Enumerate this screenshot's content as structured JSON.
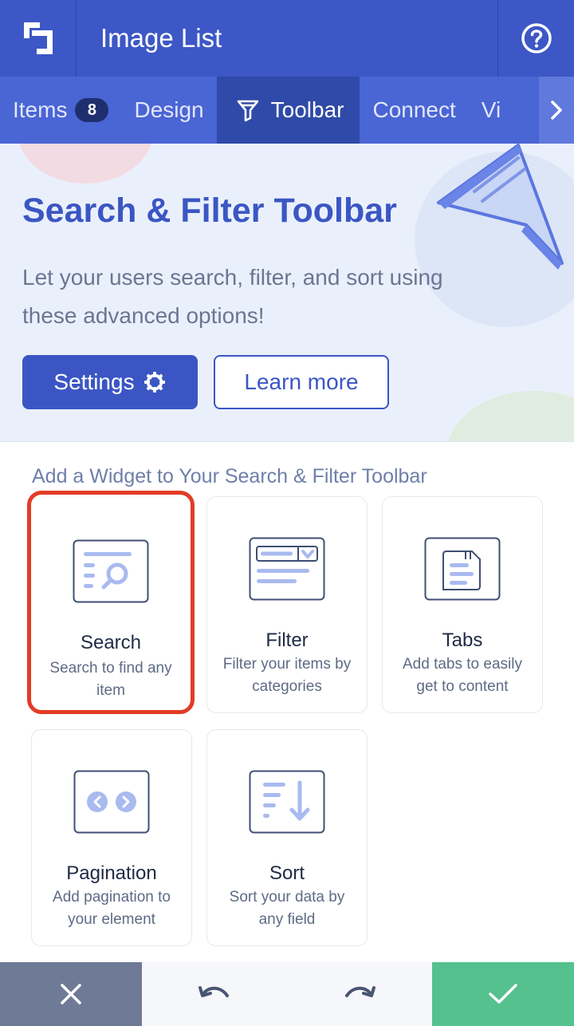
{
  "app": {
    "title": "Image List"
  },
  "tabs": [
    {
      "label": "Items",
      "badge": "8"
    },
    {
      "label": "Design"
    },
    {
      "label": "Toolbar",
      "active": true
    },
    {
      "label": "Connect"
    },
    {
      "label": "Vi"
    }
  ],
  "banner": {
    "title": "Search & Filter Toolbar",
    "description": "Let your users search, filter, and sort using these advanced options!",
    "settings_label": "Settings",
    "learn_more_label": "Learn more"
  },
  "widgets": {
    "section_title": "Add a Widget to Your Search & Filter Toolbar",
    "items": [
      {
        "title": "Search",
        "description": "Search to find any item",
        "icon": "search-widget-icon",
        "selected": true
      },
      {
        "title": "Filter",
        "description": "Filter your items by categories",
        "icon": "filter-widget-icon"
      },
      {
        "title": "Tabs",
        "description": "Add tabs to easily get to content",
        "icon": "tabs-widget-icon"
      },
      {
        "title": "Pagination",
        "description": "Add pagination to your element",
        "icon": "pagination-widget-icon"
      },
      {
        "title": "Sort",
        "description": "Sort your data by any field",
        "icon": "sort-widget-icon"
      }
    ]
  },
  "colors": {
    "primary": "#3d57c6",
    "tab_bar": "#4a65d4",
    "active_tab": "#2f4aa8",
    "selected_outline": "#e23c26",
    "confirm": "#55c18e",
    "cancel": "#6f7a97"
  }
}
